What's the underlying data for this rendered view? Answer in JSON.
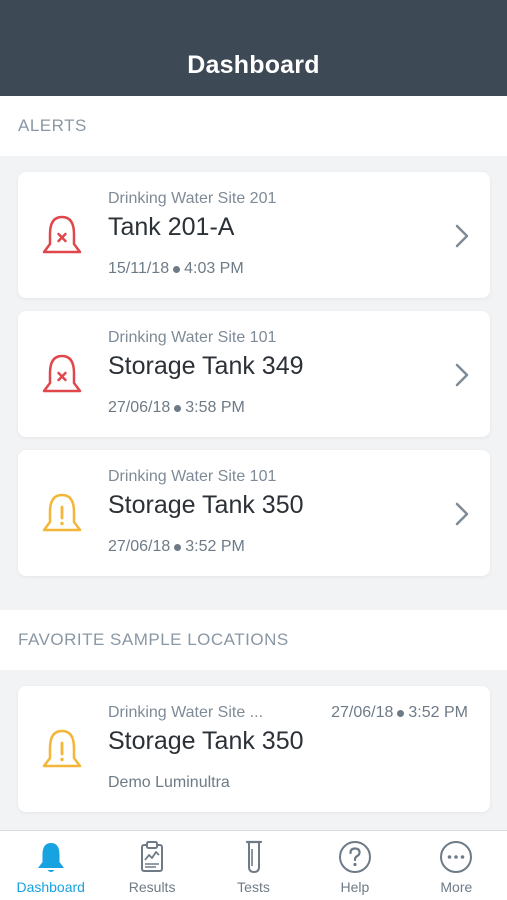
{
  "header": {
    "title": "Dashboard"
  },
  "alerts_section": {
    "title": "ALERTS"
  },
  "alerts": [
    {
      "site": "Drinking Water Site 201",
      "name": "Tank 201-A",
      "date": "15/11/18",
      "time": "4:03 PM",
      "severity": "critical",
      "icon": "bell-x-icon"
    },
    {
      "site": "Drinking Water Site 101",
      "name": "Storage Tank 349",
      "date": "27/06/18",
      "time": "3:58 PM",
      "severity": "critical",
      "icon": "bell-x-icon"
    },
    {
      "site": "Drinking Water Site 101",
      "name": "Storage Tank 350",
      "date": "27/06/18",
      "time": "3:52 PM",
      "severity": "warning",
      "icon": "bell-exclamation-icon"
    }
  ],
  "favorites_section": {
    "title": "FAVORITE SAMPLE LOCATIONS"
  },
  "favorites": [
    {
      "site": "Drinking Water Site ...",
      "name": "Storage Tank 350",
      "date": "27/06/18",
      "time": "3:52 PM",
      "org": "Demo Luminultra",
      "severity": "warning",
      "icon": "bell-exclamation-icon"
    }
  ],
  "tabs": [
    {
      "label": "Dashboard",
      "icon": "bell-icon",
      "active": true
    },
    {
      "label": "Results",
      "icon": "clipboard-chart-icon",
      "active": false
    },
    {
      "label": "Tests",
      "icon": "test-tube-icon",
      "active": false
    },
    {
      "label": "Help",
      "icon": "question-circle-icon",
      "active": false
    },
    {
      "label": "More",
      "icon": "ellipsis-circle-icon",
      "active": false
    }
  ],
  "colors": {
    "header_bg": "#3d4a55",
    "critical": "#e0474c",
    "warning": "#f4b638",
    "active_tab": "#17a2e0",
    "inactive_tab": "#6e7b87"
  }
}
